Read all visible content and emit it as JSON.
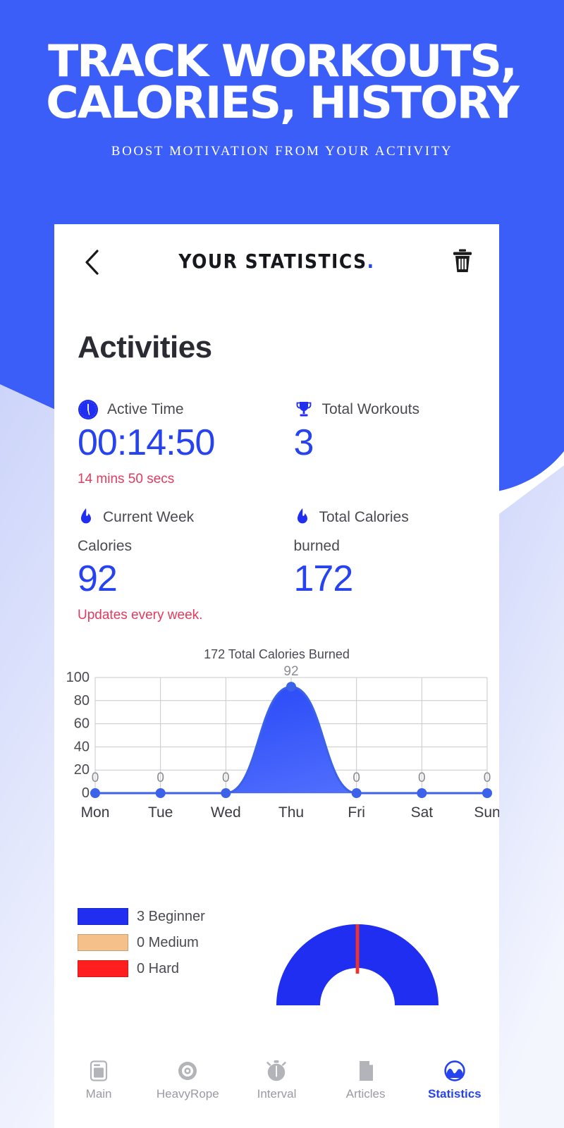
{
  "colors": {
    "brand_blue": "#3B5EF8",
    "accent_blue": "#2743f0",
    "pink": "#e33b5e",
    "pale_blue": "#e8ebfb",
    "medium_orange": "#f5c089",
    "hard_red": "#ff1f1f",
    "gray_text": "#9a9aa2"
  },
  "hero": {
    "title_line1": "TRACK WORKOUTS,",
    "title_line2": "CALORIES, HISTORY",
    "subtitle": "BOOST MOTIVATION FROM YOUR ACTIVITY"
  },
  "app": {
    "header": {
      "back_icon": "chevron-left-icon",
      "title": "YOUR STATISTICS",
      "title_dot": ".",
      "delete_icon": "trash-icon"
    },
    "section_title": "Activities",
    "stats": [
      {
        "icon": "clock-icon",
        "label": "Active Time",
        "label2": "",
        "value": "00:14:50",
        "note": "14 mins 50 secs"
      },
      {
        "icon": "trophy-icon",
        "label": "Total Workouts",
        "label2": "",
        "value": "3",
        "note": ""
      },
      {
        "icon": "flame-icon",
        "label": "Current Week",
        "label2": "Calories",
        "value": "92",
        "note": "Updates every week."
      },
      {
        "icon": "flame-icon",
        "label": "Total Calories",
        "label2": "burned",
        "value": "172",
        "note": ""
      }
    ],
    "legend": [
      {
        "label": "3 Beginner",
        "color": "#1f2ef0"
      },
      {
        "label": "0 Medium",
        "color": "#f5c089"
      },
      {
        "label": "0 Hard",
        "color": "#ff1f1f"
      }
    ],
    "nav": [
      {
        "label": "Main",
        "icon": "phone-card-icon",
        "active": false
      },
      {
        "label": "HeavyRope",
        "icon": "target-circle-icon",
        "active": false
      },
      {
        "label": "Interval",
        "icon": "stopwatch-icon",
        "active": false
      },
      {
        "label": "Articles",
        "icon": "document-icon",
        "active": false
      },
      {
        "label": "Statistics",
        "icon": "wave-circle-icon",
        "active": true
      }
    ]
  },
  "chart_data": [
    {
      "type": "area",
      "title": "172 Total Calories Burned",
      "categories": [
        "Mon",
        "Tue",
        "Wed",
        "Thu",
        "Fri",
        "Sat",
        "Sun"
      ],
      "values": [
        0,
        0,
        0,
        92,
        0,
        0,
        0
      ],
      "point_labels": [
        "0",
        "0",
        "0",
        "92",
        "0",
        "0",
        "0"
      ],
      "yticks": [
        0,
        20,
        40,
        60,
        80,
        100
      ],
      "ylim": [
        0,
        100
      ],
      "xlabel": "",
      "ylabel": "",
      "grid": true,
      "legend": "none",
      "line_color": "#3b62e8",
      "fill_color": "#2f51f0"
    },
    {
      "type": "pie",
      "title": "",
      "categories": [
        "Beginner",
        "Medium",
        "Hard"
      ],
      "values": [
        3,
        0,
        0
      ],
      "colors": [
        "#1f2ef0",
        "#f5c089",
        "#ff1f1f"
      ],
      "donut": true,
      "legend": "left"
    }
  ]
}
